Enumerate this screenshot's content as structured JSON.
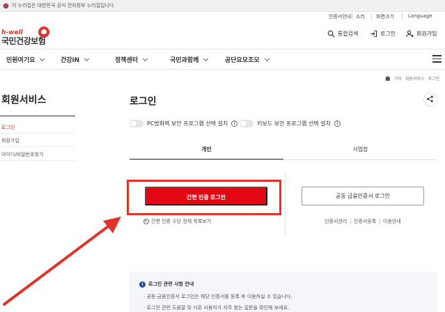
{
  "gov_banner": {
    "text": "이 누리집은 대한민국 공식 전자정부 누리집입니다."
  },
  "utility": {
    "items": [
      "인증서안내",
      "소리",
      "화면크기",
      "Language"
    ]
  },
  "logo": {
    "en": "h-well",
    "kr": "국민건강보험"
  },
  "header_links": {
    "search": "통합검색",
    "login": "로그인",
    "join": "회원가입"
  },
  "gnb": {
    "items": [
      "민원여기요",
      "건강iN",
      "정책센터",
      "국민과함께",
      "공단요모조모"
    ]
  },
  "breadcrumb": {
    "items": [
      "기타",
      "회원서비스",
      "로그인"
    ]
  },
  "sidebar": {
    "title": "회원서비스",
    "items": [
      {
        "label": "로그인",
        "active": true
      },
      {
        "label": "회원가입",
        "active": false
      },
      {
        "label": "아이디/비밀번호찾기",
        "active": false
      }
    ]
  },
  "main": {
    "title": "로그인",
    "toggles": [
      "PC방화벽 보안 프로그램 선택 설치",
      "키보드 보안 프로그램 선택 설치"
    ],
    "tabs": [
      "개인",
      "사업장"
    ],
    "simple_login": {
      "button": "간편 인증 로그인",
      "methods_link": "간편 인증 수단 전체 목록보기"
    },
    "cert_login": {
      "button": "공동 금융인증서 로그인",
      "links": [
        "인증서관리",
        "인증서등록",
        "이용안내"
      ]
    },
    "notice": {
      "title": "로그인 관련 사항 안내",
      "lines": [
        "공동·금융인증서 로그인은 해당 인증서를 등록 후 이용하실 수 있습니다.",
        "로그인 관련 도움말 및 다른 사용자가 자주 찾는 질문을 확인해 보세요."
      ]
    }
  },
  "colors": {
    "accent": "#e2322c",
    "button_red": "#e30613",
    "annotation_red": "#e2322c"
  }
}
